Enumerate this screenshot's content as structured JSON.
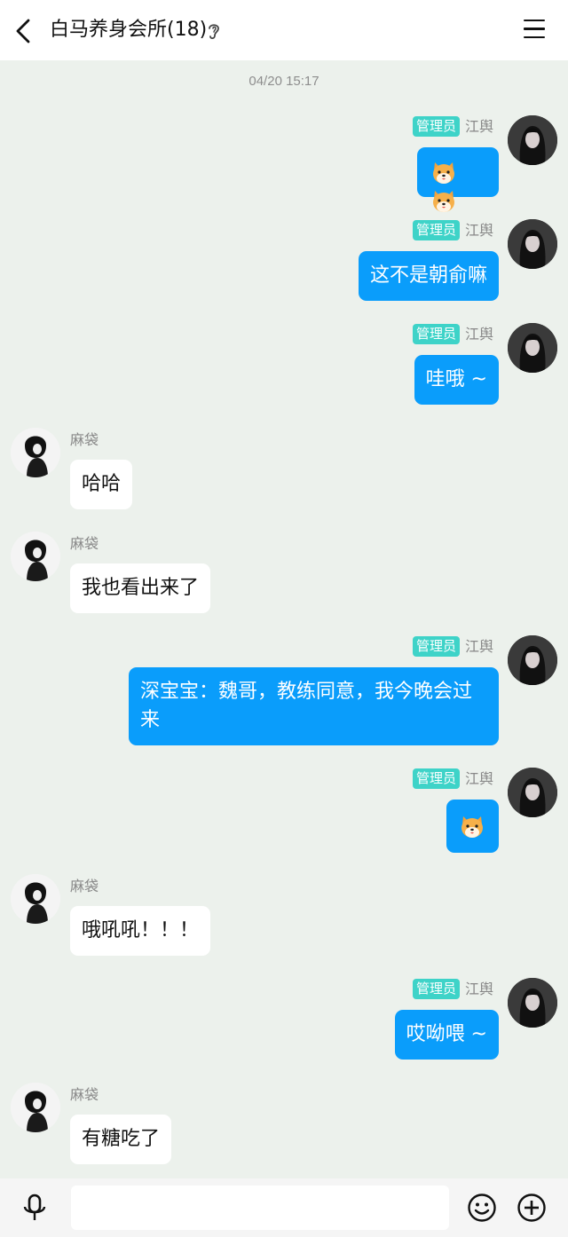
{
  "header": {
    "title": "白马养身会所(18)"
  },
  "timestamp": "04/20 15:17",
  "messages": [
    {
      "side": "right",
      "badge": "管理员",
      "sender": "江舆",
      "text": "",
      "emojis": 2
    },
    {
      "side": "right",
      "badge": "管理员",
      "sender": "江舆",
      "text": "这不是朝俞嘛"
    },
    {
      "side": "right",
      "badge": "管理员",
      "sender": "江舆",
      "text": "哇哦 ~"
    },
    {
      "side": "left",
      "sender": "麻袋",
      "text": "哈哈"
    },
    {
      "side": "left",
      "sender": "麻袋",
      "text": "我也看出来了"
    },
    {
      "side": "right",
      "badge": "管理员",
      "sender": "江舆",
      "text": "深宝宝：魏哥，教练同意，我今晚会过来"
    },
    {
      "side": "right",
      "badge": "管理员",
      "sender": "江舆",
      "text": "",
      "emojis": 1
    },
    {
      "side": "left",
      "sender": "麻袋",
      "text": "哦吼吼！！！"
    },
    {
      "side": "right",
      "badge": "管理员",
      "sender": "江舆",
      "text": "哎呦喂 ~"
    },
    {
      "side": "left",
      "sender": "麻袋",
      "text": "有糖吃了"
    }
  ]
}
